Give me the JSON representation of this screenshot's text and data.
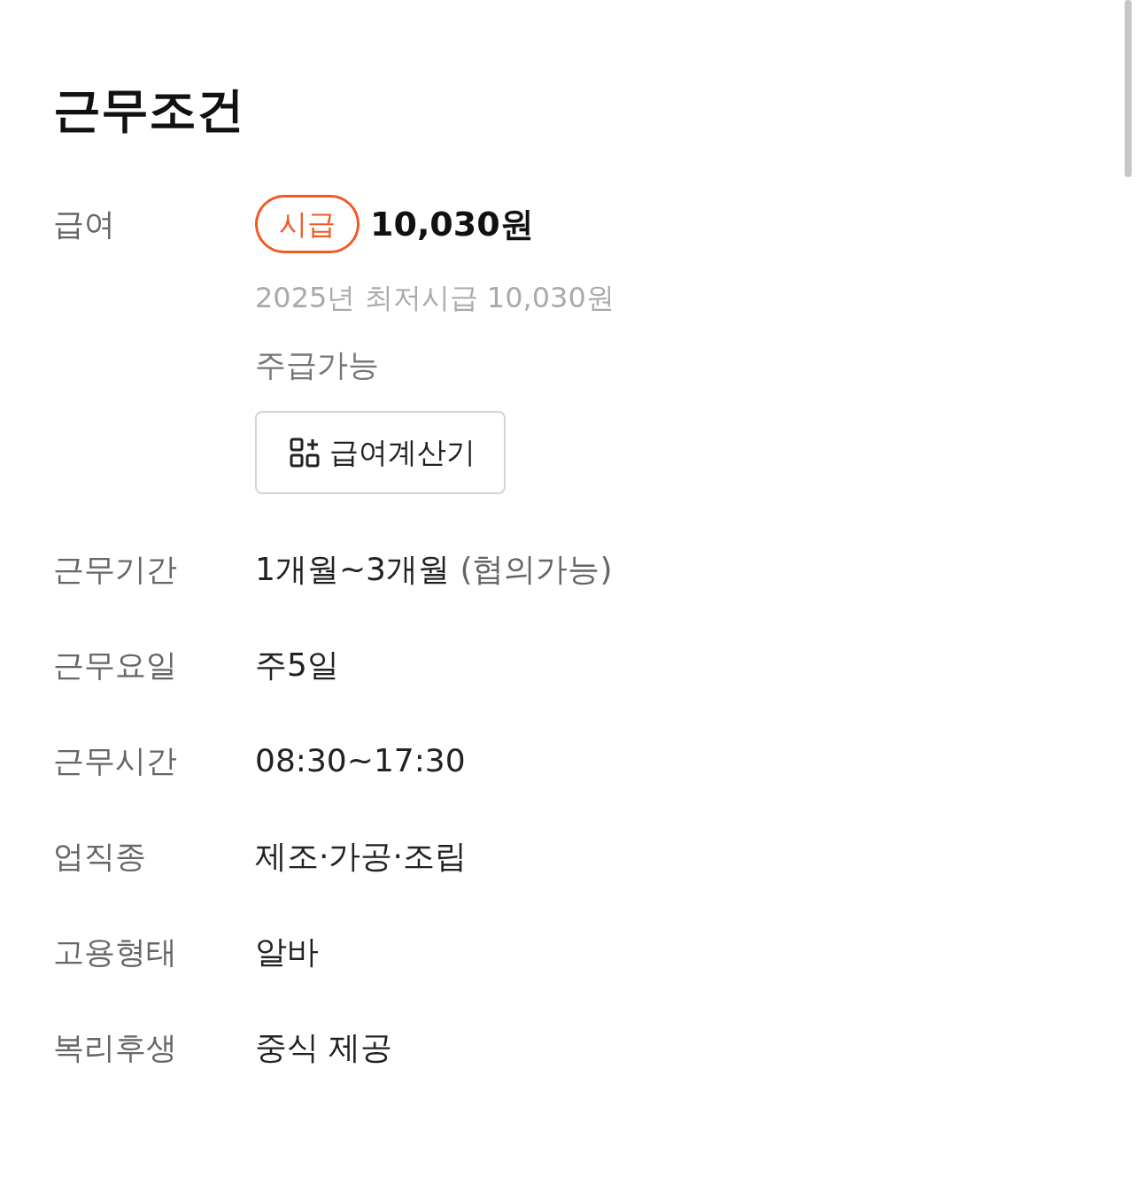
{
  "title": "근무조건",
  "salary": {
    "label": "급여",
    "badge": "시급",
    "amount": "10,030원",
    "minimum_wage_note": "2025년 최저시급 10,030원",
    "weekly_pay": "주급가능",
    "calculator_button": "급여계산기"
  },
  "conditions": [
    {
      "label": "근무기간",
      "value": "1개월~3개월",
      "note": "(협의가능)"
    },
    {
      "label": "근무요일",
      "value": "주5일"
    },
    {
      "label": "근무시간",
      "value": "08:30~17:30"
    },
    {
      "label": "업직종",
      "value": "제조·가공·조립"
    },
    {
      "label": "고용형태",
      "value": "알바"
    },
    {
      "label": "복리후생",
      "value": "중식 제공"
    }
  ]
}
